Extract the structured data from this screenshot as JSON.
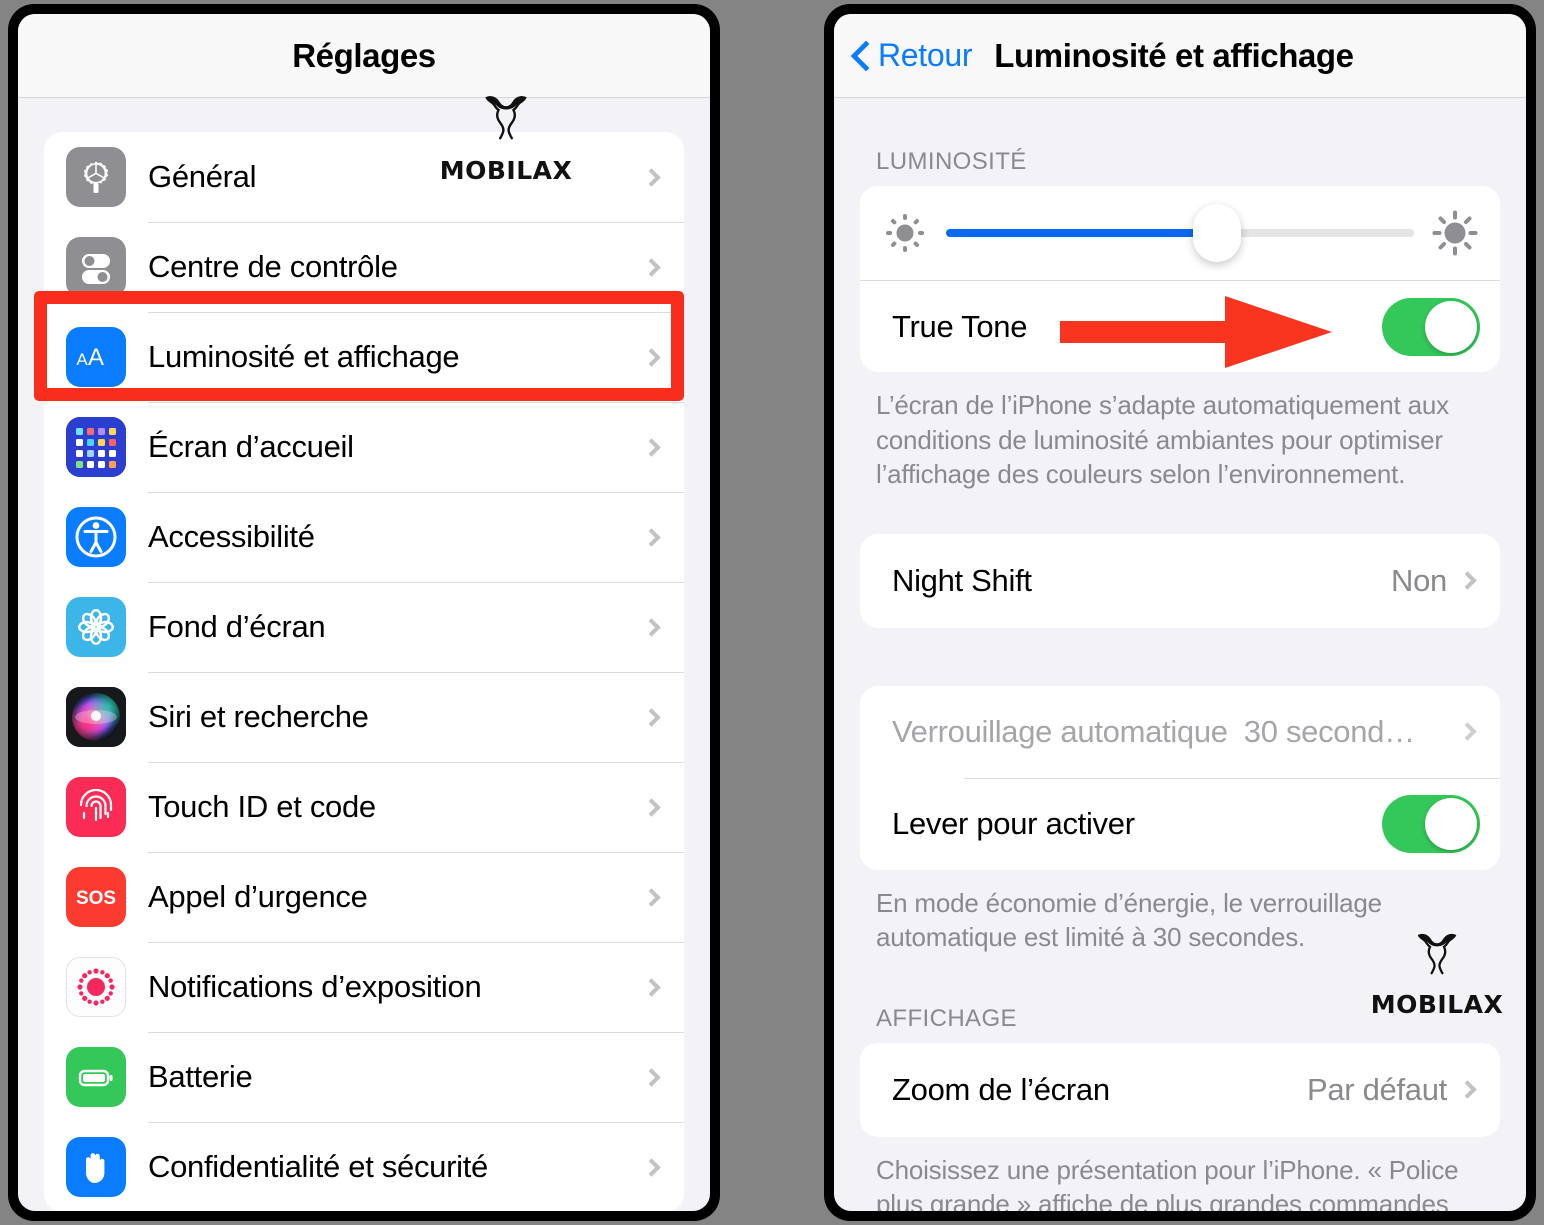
{
  "meta": {
    "background_color": "#848484",
    "accent_blue": "#0a7cff",
    "toggle_green": "#34c759",
    "highlight_red": "#f92d1c"
  },
  "left_phone": {
    "navbar": {
      "title": "Réglages"
    },
    "items": [
      {
        "label": "Général",
        "icon": "gear-icon",
        "icon_name": "settings-general-icon"
      },
      {
        "label": "Centre de contrôle",
        "icon": "control-center-icon",
        "icon_name": "control-center-icon"
      },
      {
        "label": "Luminosité et affichage",
        "icon": "aa-icon",
        "icon_name": "display-brightness-icon"
      },
      {
        "label": "Écran d’accueil",
        "icon": "home-screen-icon",
        "icon_name": "home-screen-icon"
      },
      {
        "label": "Accessibilité",
        "icon": "accessibility-icon",
        "icon_name": "accessibility-icon"
      },
      {
        "label": "Fond d’écran",
        "icon": "wallpaper-icon",
        "icon_name": "wallpaper-icon"
      },
      {
        "label": "Siri et recherche",
        "icon": "siri-icon",
        "icon_name": "siri-icon"
      },
      {
        "label": "Touch ID et code",
        "icon": "fingerprint-icon",
        "icon_name": "touch-id-icon"
      },
      {
        "label": "Appel d’urgence",
        "icon": "sos-icon",
        "icon_name": "emergency-sos-icon"
      },
      {
        "label": "Notifications d’exposition",
        "icon": "exposure-icon",
        "icon_name": "exposure-notifications-icon"
      },
      {
        "label": "Batterie",
        "icon": "battery-icon",
        "icon_name": "battery-icon"
      },
      {
        "label": "Confidentialité et sécurité",
        "icon": "hand-icon",
        "icon_name": "privacy-security-icon"
      }
    ],
    "highlighted_item_label": "Luminosité et affichage"
  },
  "right_phone": {
    "navbar": {
      "back_label": "Retour",
      "back_icon": "chevron-left-icon",
      "title": "Luminosité et affichage"
    },
    "brightness_section": {
      "header": "LUMINOSITÉ",
      "slider": {
        "min_icon": "sun-low-icon",
        "max_icon": "sun-high-icon",
        "value_percent": 58
      },
      "true_tone": {
        "label": "True Tone",
        "state": "on"
      },
      "footer": "L’écran de l’iPhone s’adapte automatiquement aux conditions de luminosité ambiantes pour optimiser l’affichage des couleurs selon l’environnement."
    },
    "night_shift": {
      "label": "Night Shift",
      "value": "Non"
    },
    "lock_section": {
      "auto_lock": {
        "label": "Verrouillage automatique",
        "value": "30 second…",
        "disabled": true
      },
      "raise_to_wake": {
        "label": "Lever pour activer",
        "state": "on"
      },
      "footer": "En mode économie d’énergie, le verrouillage automatique est limité à 30 secondes."
    },
    "display_section": {
      "header": "AFFICHAGE",
      "screen_zoom": {
        "label": "Zoom de l’écran",
        "value": "Par défaut"
      },
      "footer": "Choisissez une présentation pour l’iPhone. « Police plus grande » affiche de plus grandes commandes"
    }
  },
  "annotations": {
    "arrow": {
      "name": "red-arrow-pointing-to-true-tone-toggle",
      "color": "#f9351f"
    },
    "highlight_box": {
      "name": "red-highlight-box",
      "color": "#f92d1c"
    }
  },
  "watermarks": [
    {
      "text": "MOBILAX",
      "location": "left-phone-top"
    },
    {
      "text": "MOBILAX",
      "location": "right-phone-bottom"
    }
  ]
}
